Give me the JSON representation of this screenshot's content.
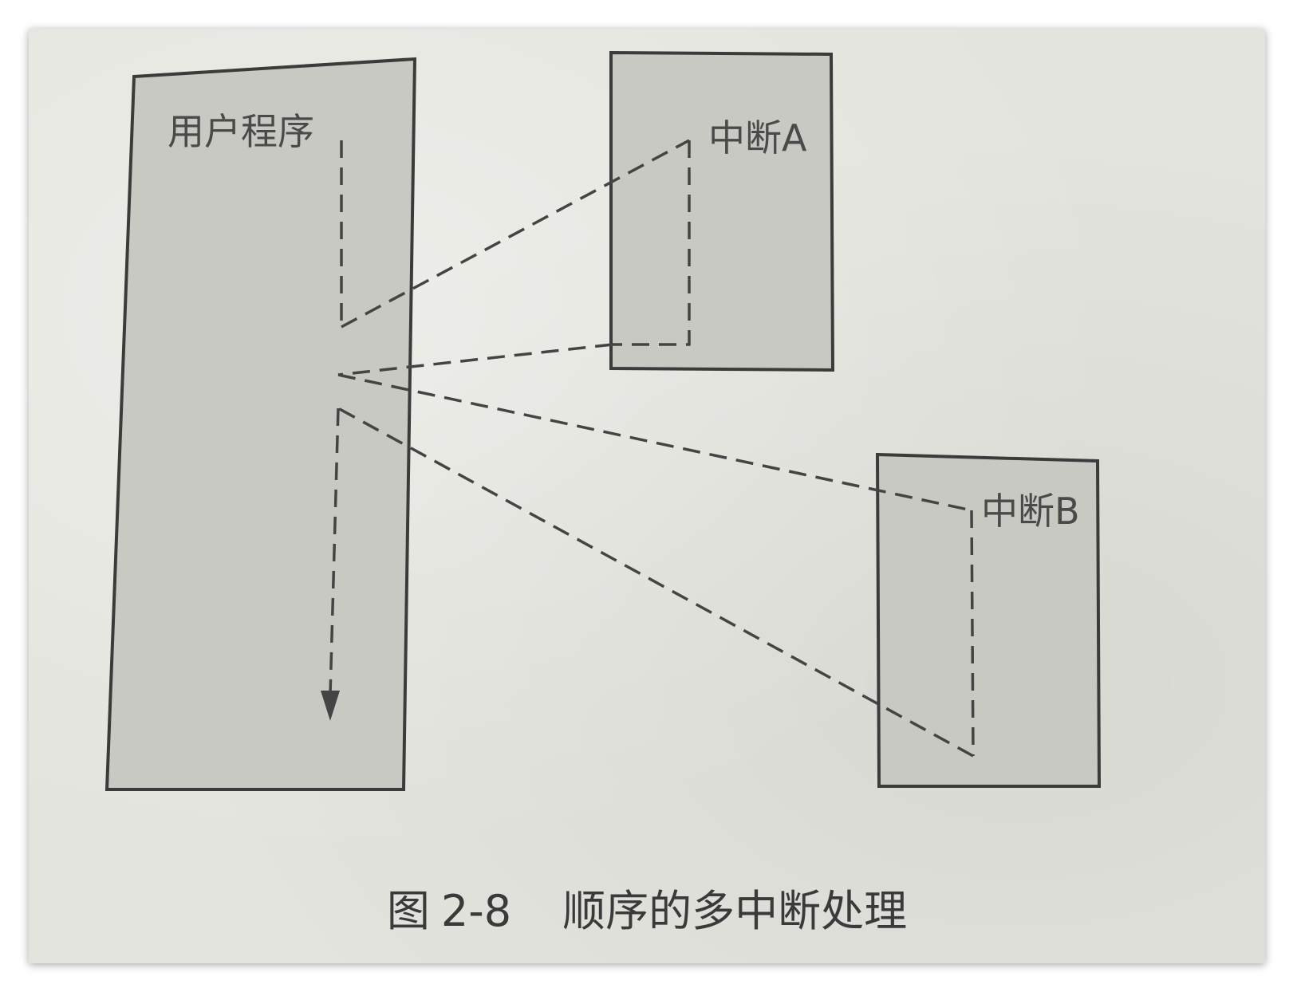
{
  "nodes": {
    "user_program": {
      "label": "用户程序"
    },
    "interrupt_a": {
      "label": "中断A"
    },
    "interrupt_b": {
      "label": "中断B"
    }
  },
  "caption": {
    "figure": "图",
    "number": "2-8",
    "text": "顺序的多中断处理"
  },
  "colors": {
    "background": "#e4e4de",
    "box_fill": "#c9c9c4",
    "line": "#444444"
  }
}
